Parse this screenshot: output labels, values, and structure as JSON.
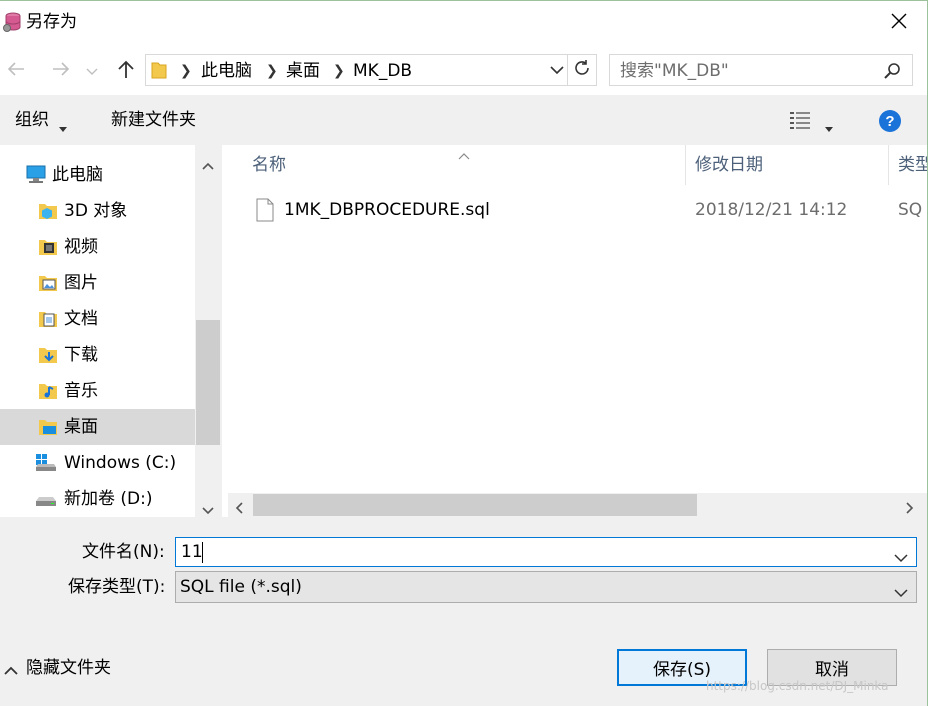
{
  "window": {
    "title": "另存为",
    "close_glyph": "✕"
  },
  "nav": {
    "back_glyph": "←",
    "forward_glyph": "→",
    "recent_glyph": "⌄",
    "up_glyph": "↑",
    "breadcrumb": [
      "此电脑",
      "桌面",
      "MK_DB"
    ],
    "search_placeholder": "搜索\"MK_DB\""
  },
  "toolbar": {
    "organize_label": "组织",
    "new_folder_label": "新建文件夹"
  },
  "sidebar": {
    "items": [
      {
        "label": "此电脑",
        "icon": "computer-icon"
      },
      {
        "label": "3D 对象",
        "icon": "3d-objects-folder-icon"
      },
      {
        "label": "视频",
        "icon": "videos-folder-icon"
      },
      {
        "label": "图片",
        "icon": "pictures-folder-icon"
      },
      {
        "label": "文档",
        "icon": "documents-folder-icon"
      },
      {
        "label": "下载",
        "icon": "downloads-folder-icon"
      },
      {
        "label": "音乐",
        "icon": "music-folder-icon"
      },
      {
        "label": "桌面",
        "icon": "desktop-folder-icon",
        "selected": true
      },
      {
        "label": "Windows (C:)",
        "icon": "windows-drive-icon"
      },
      {
        "label": "新加卷 (D:)",
        "icon": "drive-icon"
      }
    ]
  },
  "filelist": {
    "columns": {
      "name": "名称",
      "date": "修改日期",
      "type": "类型"
    },
    "files": [
      {
        "name": "1MK_DBPROCEDURE.sql",
        "date": "2018/12/21 14:12",
        "type": "SQ"
      }
    ]
  },
  "form": {
    "filename_label": "文件名(N):",
    "filename_value": "11",
    "filetype_label": "保存类型(T):",
    "filetype_value": "SQL file (*.sql)"
  },
  "footer": {
    "hide_folders_label": "隐藏文件夹",
    "save_label": "保存(S)",
    "cancel_label": "取消",
    "watermark": "https://blog.csdn.net/DJ_Minka"
  },
  "colors": {
    "accent": "#0078d7",
    "selected_bg": "#d9d9d9",
    "toolbar_bg": "#f0f0f0",
    "column_header": "#4c607a"
  }
}
